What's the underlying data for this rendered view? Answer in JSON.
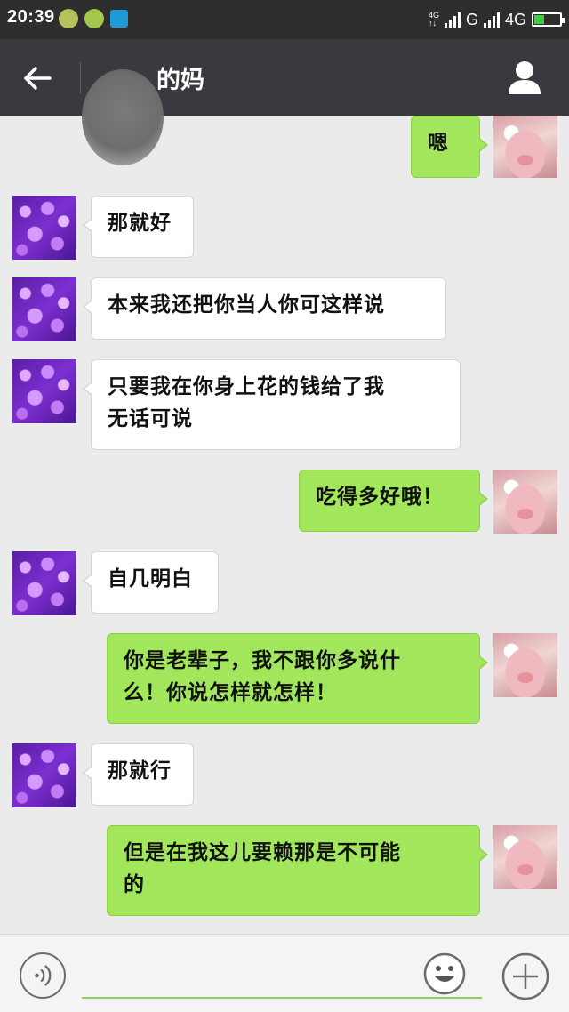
{
  "status_bar": {
    "time": "20:39",
    "network_small": "4G",
    "network_g": "G",
    "network_4g": "4G"
  },
  "header": {
    "title": "的妈",
    "back_icon": "arrow-left-icon",
    "profile_icon": "person-icon"
  },
  "messages": [
    {
      "side": "out",
      "text": "嗯"
    },
    {
      "side": "in",
      "text": "那就好"
    },
    {
      "side": "in",
      "text": "本来我还把你当人你可这样说"
    },
    {
      "side": "in",
      "line1": "只要我在你身上花的钱给了我",
      "line2": "无话可说"
    },
    {
      "side": "out",
      "text": "吃得多好哦！"
    },
    {
      "side": "in",
      "text": "自几明白"
    },
    {
      "side": "out",
      "line1": "你是老辈子，我不跟你多说什",
      "line2": "么！你说怎样就怎样！"
    },
    {
      "side": "in",
      "text": "那就行"
    },
    {
      "side": "out",
      "line1": "但是在我这儿要赖那是不可能",
      "line2": "的"
    }
  ],
  "colors": {
    "outgoing_bubble": "#a2e65b",
    "incoming_bubble": "#ffffff",
    "title_bar": "#393a3f",
    "status_bar": "#2e2e2e"
  }
}
